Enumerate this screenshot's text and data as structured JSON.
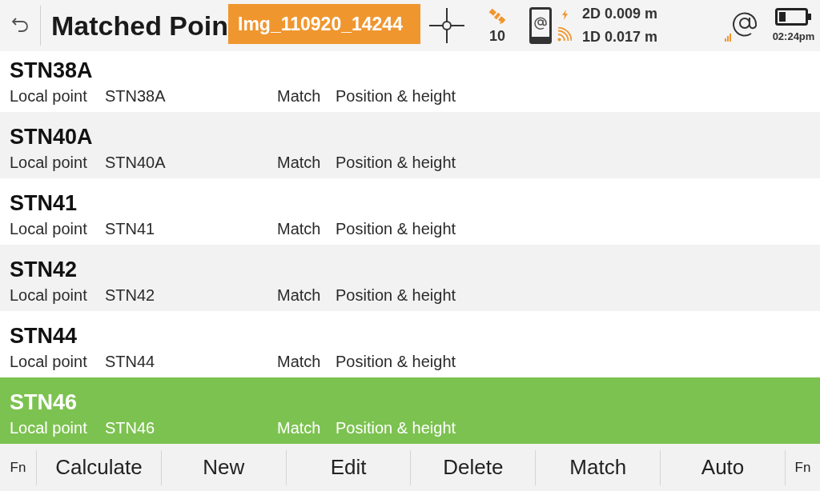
{
  "header": {
    "title": "Matched Poin",
    "overlay_label": "Img_110920_14244",
    "satellites": "10",
    "precision": [
      "2D 0.009 m",
      "1D 0.017 m"
    ],
    "time": "02:24pm"
  },
  "points": [
    {
      "name": "STN38A",
      "local_label": "Local point",
      "local_point": "STN38A",
      "match_label": "Match",
      "match": "Position & height",
      "selected": false
    },
    {
      "name": "STN40A",
      "local_label": "Local point",
      "local_point": "STN40A",
      "match_label": "Match",
      "match": "Position & height",
      "selected": false
    },
    {
      "name": "STN41",
      "local_label": "Local point",
      "local_point": "STN41",
      "match_label": "Match",
      "match": "Position & height",
      "selected": false
    },
    {
      "name": "STN42",
      "local_label": "Local point",
      "local_point": "STN42",
      "match_label": "Match",
      "match": "Position & height",
      "selected": false
    },
    {
      "name": "STN44",
      "local_label": "Local point",
      "local_point": "STN44",
      "match_label": "Match",
      "match": "Position & height",
      "selected": false
    },
    {
      "name": "STN46",
      "local_label": "Local point",
      "local_point": "STN46",
      "match_label": "Match",
      "match": "Position & height",
      "selected": true
    }
  ],
  "toolbar": {
    "left_fn": "Fn",
    "buttons": [
      "Calculate",
      "New",
      "Edit",
      "Delete",
      "Match",
      "Auto"
    ],
    "right_fn": "Fn"
  }
}
